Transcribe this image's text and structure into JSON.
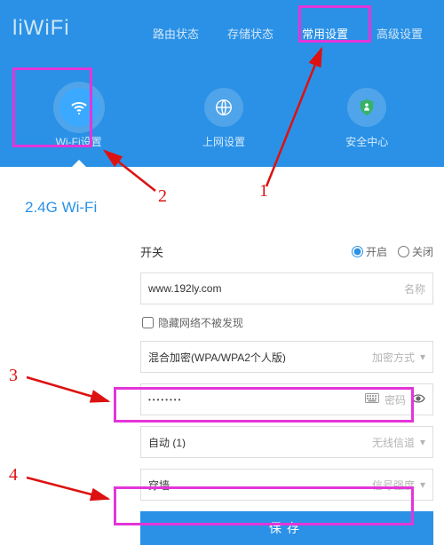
{
  "brand": "liWiFi",
  "topnav": {
    "items": [
      {
        "label": "路由状态"
      },
      {
        "label": "存储状态"
      },
      {
        "label": "常用设置"
      },
      {
        "label": "高级设置"
      }
    ],
    "active_index": 2
  },
  "subnav": {
    "items": [
      {
        "label": "Wi-Fi设置",
        "icon": "wifi-icon"
      },
      {
        "label": "上网设置",
        "icon": "globe-icon"
      },
      {
        "label": "安全中心",
        "icon": "shield-icon"
      }
    ],
    "active_index": 0
  },
  "section_title": "2.4G Wi-Fi",
  "form": {
    "switch_label": "开关",
    "switch_on": "开启",
    "switch_off": "关闭",
    "switch_value": "on",
    "name_value": "www.192ly.com",
    "name_suffix": "名称",
    "hide_ssid_label": "隐藏网络不被发现",
    "hide_ssid_checked": false,
    "encryption_value": "混合加密(WPA/WPA2个人版)",
    "encryption_suffix": "加密方式",
    "password_value": "••••••••",
    "password_suffix": "密码",
    "channel_value": "自动 (1)",
    "channel_suffix": "无线信道",
    "signal_value": "穿墙",
    "signal_suffix": "信号强度",
    "save_label": "保存"
  },
  "annotations": {
    "n1": "1",
    "n2": "2",
    "n3": "3",
    "n4": "4"
  }
}
